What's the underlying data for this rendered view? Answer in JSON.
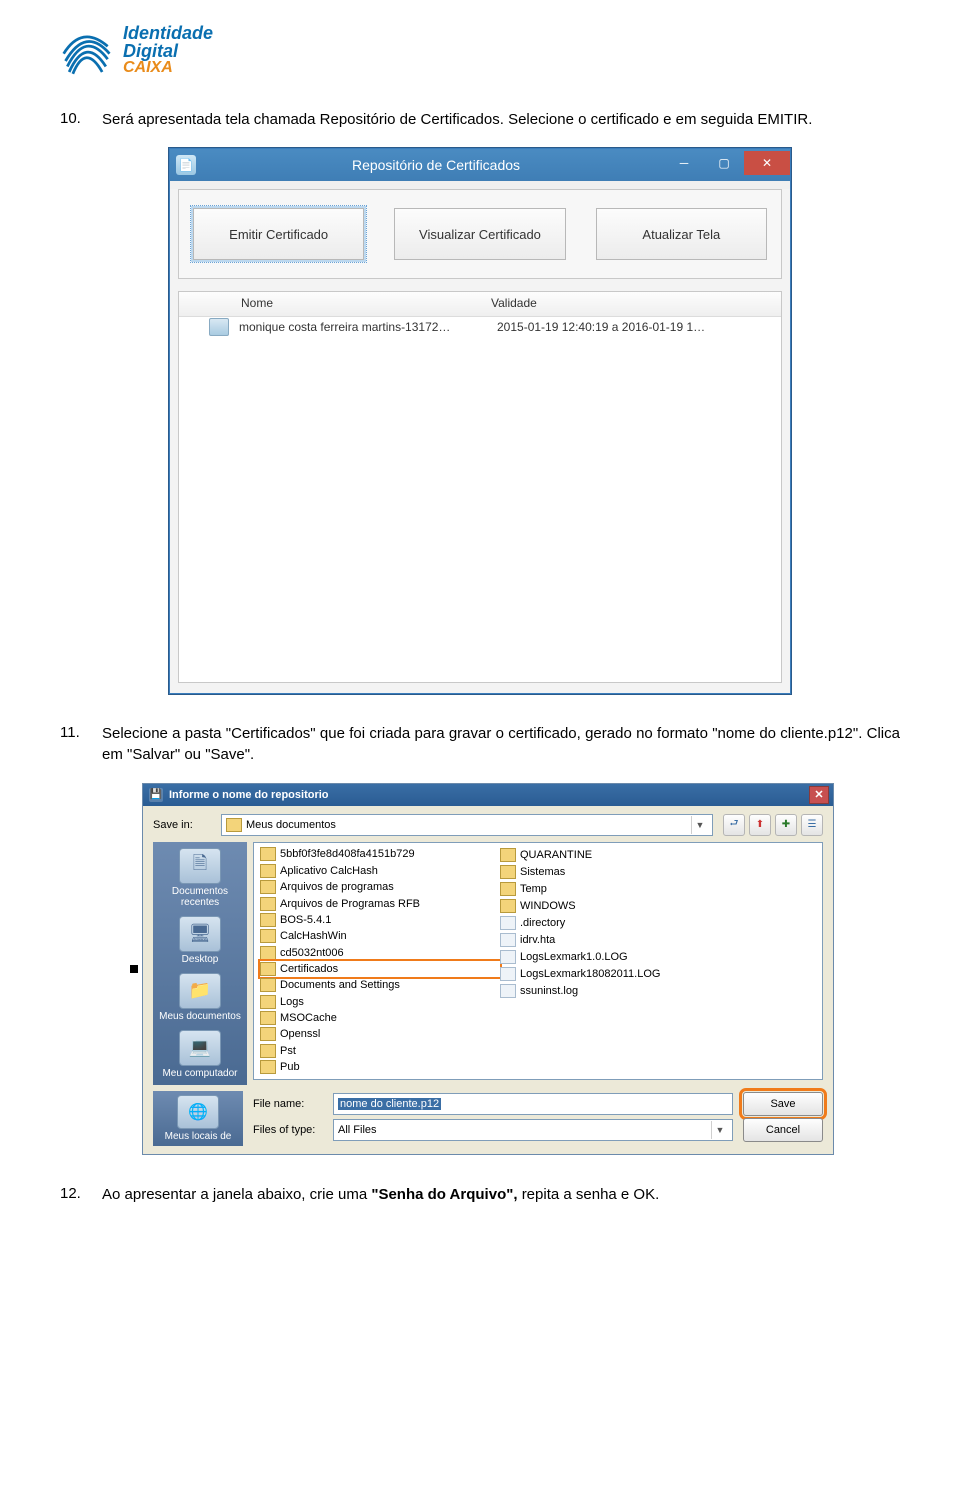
{
  "logo": {
    "line1": "Identidade",
    "line2": "Digital",
    "line3": "CAIXA"
  },
  "step10": {
    "num": "10.",
    "text": "Será apresentada tela chamada Repositório de Certificados. Selecione o certificado e em seguida EMITIR."
  },
  "step11": {
    "num": "11.",
    "text": "Selecione a pasta \"Certificados\" que foi criada para gravar o certificado, gerado no formato \"nome do cliente.p12\". Clica em \"Salvar\" ou \"Save\"."
  },
  "step12": {
    "num": "12.",
    "text_prefix": "Ao apresentar a janela abaixo, crie uma ",
    "text_bold": "\"Senha do Arquivo\", ",
    "text_suffix": "repita a senha e OK."
  },
  "win8": {
    "title": "Repositório de Certificados",
    "buttons": {
      "emit": "Emitir Certificado",
      "view": "Visualizar Certificado",
      "refresh": "Atualizar Tela"
    },
    "cols": {
      "nome": "Nome",
      "validade": "Validade"
    },
    "row": {
      "nome": "monique costa ferreira martins-13172…",
      "validade": "2015-01-19 12:40:19 a 2016-01-19 1…"
    }
  },
  "xp": {
    "title": "Informe o nome do repositorio",
    "savein_label": "Save in:",
    "savein_value": "Meus documentos",
    "places": {
      "recent": "Documentos recentes",
      "desktop": "Desktop",
      "mydocs": "Meus documentos",
      "mycomp": "Meu computador",
      "mynet": "Meus locais de"
    },
    "col1": [
      "5bbf0f3fe8d408fa4151b729",
      "Aplicativo CalcHash",
      "Arquivos de programas",
      "Arquivos de Programas RFB",
      "BOS-5.4.1",
      "CalcHashWin",
      "cd5032nt006",
      "Certificados",
      "Documents and Settings",
      "Logs",
      "MSOCache",
      "Openssl",
      "Pst",
      "Pub"
    ],
    "col2": [
      {
        "name": "QUARANTINE",
        "type": "folder"
      },
      {
        "name": "Sistemas",
        "type": "folder"
      },
      {
        "name": "Temp",
        "type": "folder"
      },
      {
        "name": "WINDOWS",
        "type": "folder"
      },
      {
        "name": ".directory",
        "type": "file"
      },
      {
        "name": "idrv.hta",
        "type": "file"
      },
      {
        "name": "LogsLexmark1.0.LOG",
        "type": "file"
      },
      {
        "name": "LogsLexmark18082011.LOG",
        "type": "file"
      },
      {
        "name": "ssuninst.log",
        "type": "file"
      }
    ],
    "filename_label": "File name:",
    "filename_value": "nome do cliente.p12",
    "filetype_label": "Files of type:",
    "filetype_value": "All Files",
    "save_btn": "Save",
    "cancel_btn": "Cancel"
  }
}
